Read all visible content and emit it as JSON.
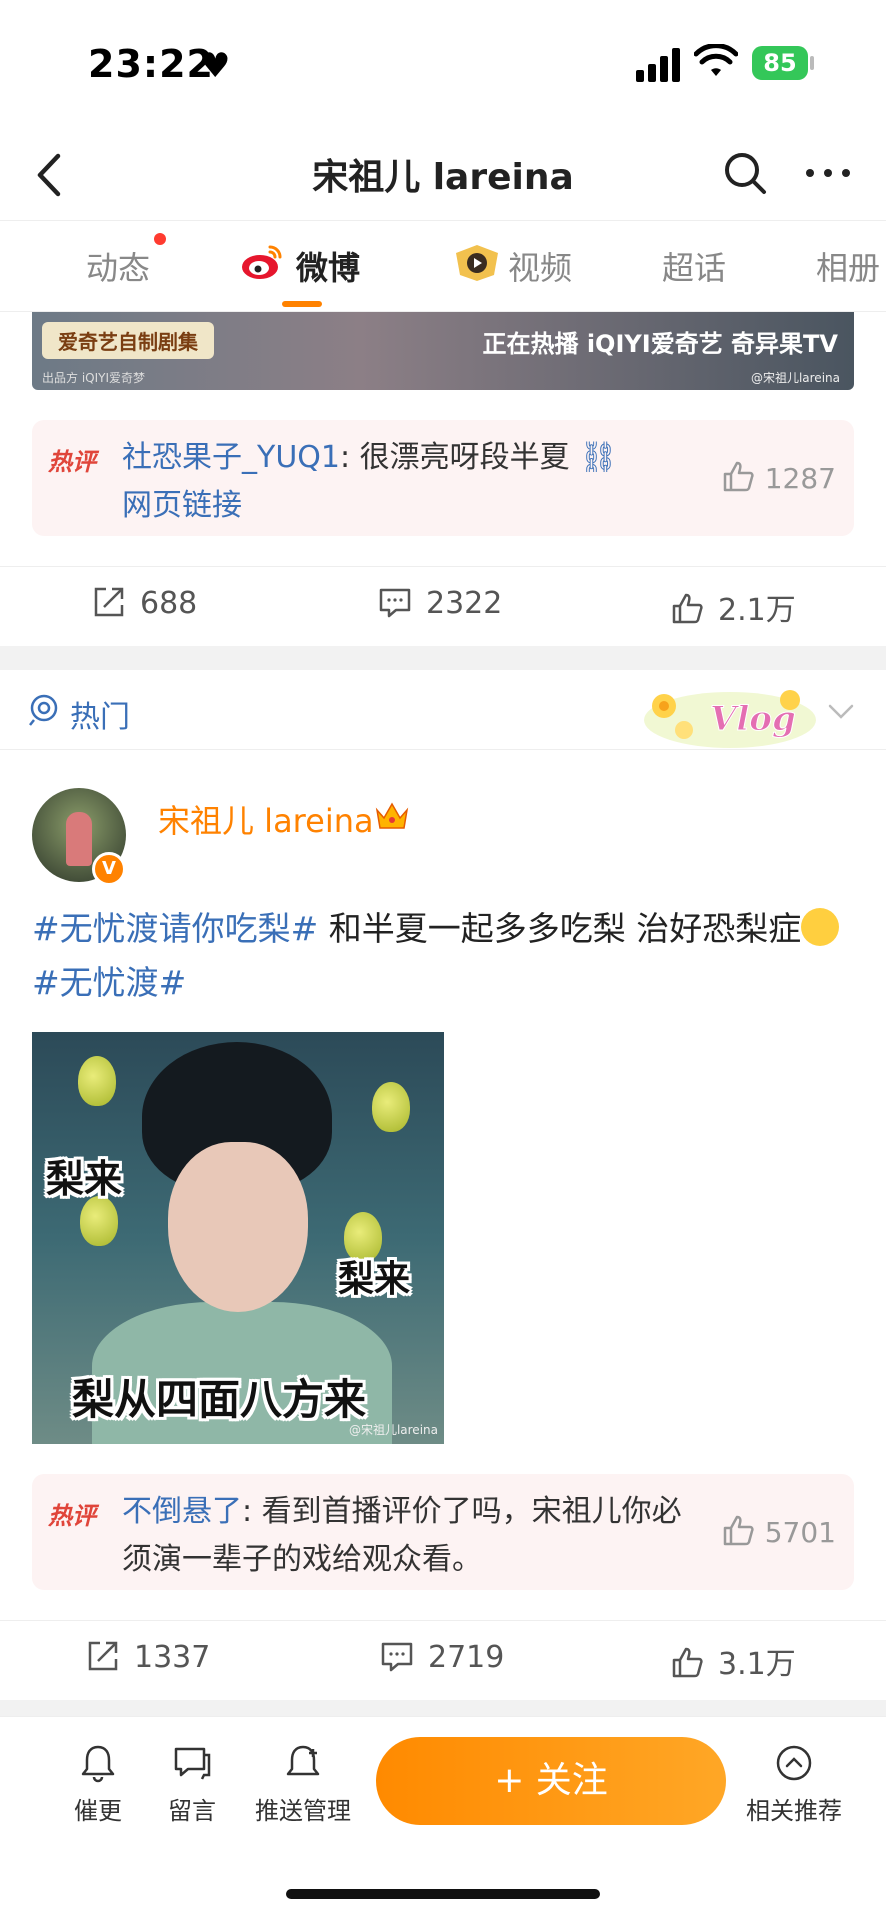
{
  "status": {
    "time": "23:22",
    "battery": "85"
  },
  "header": {
    "title": "宋祖儿 lareina"
  },
  "tabs": [
    {
      "label": "动态"
    },
    {
      "label": "微博"
    },
    {
      "label": "视频"
    },
    {
      "label": "超话"
    },
    {
      "label": "相册"
    }
  ],
  "post1": {
    "banner_left": "爱奇艺自制剧集",
    "banner_right": "正在热播 iQIYI爱奇艺 奇异果TV",
    "banner_small": "出品方 iQIYI爱奇梦",
    "banner_watermark": "@宋祖儿lareina",
    "hot_tag": "热评",
    "hot_user": "社恐果子_YUQ1",
    "hot_text": ": 很漂亮呀段半夏",
    "hot_link": "网页链接",
    "hot_likes": "1287",
    "reposts": "688",
    "comments": "2322",
    "likes": "2.1万"
  },
  "hot_section": {
    "label": "热门",
    "sticker": "Vlog"
  },
  "post2": {
    "author": "宋祖儿 lareina",
    "text_tag1": "#无忧渡请你吃梨#",
    "text_body": " 和半夏一起多多吃梨 治好恐梨症",
    "text_tag2": "#无忧渡#",
    "image_caption1": "梨来",
    "image_caption2": "梨来",
    "image_caption3": "梨从四面八方来",
    "image_watermark": "@宋祖儿lareina",
    "hot_tag": "热评",
    "hot_user": "不倒悬了",
    "hot_text": ": 看到首播评价了吗，宋祖儿你必须演一辈子的戏给观众看。",
    "hot_likes": "5701",
    "reposts": "1337",
    "comments": "2719",
    "likes": "3.1万"
  },
  "bottom_bar": {
    "remind": "催更",
    "message": "留言",
    "push": "推送管理",
    "follow": "+ 关注",
    "recommend": "相关推荐"
  }
}
